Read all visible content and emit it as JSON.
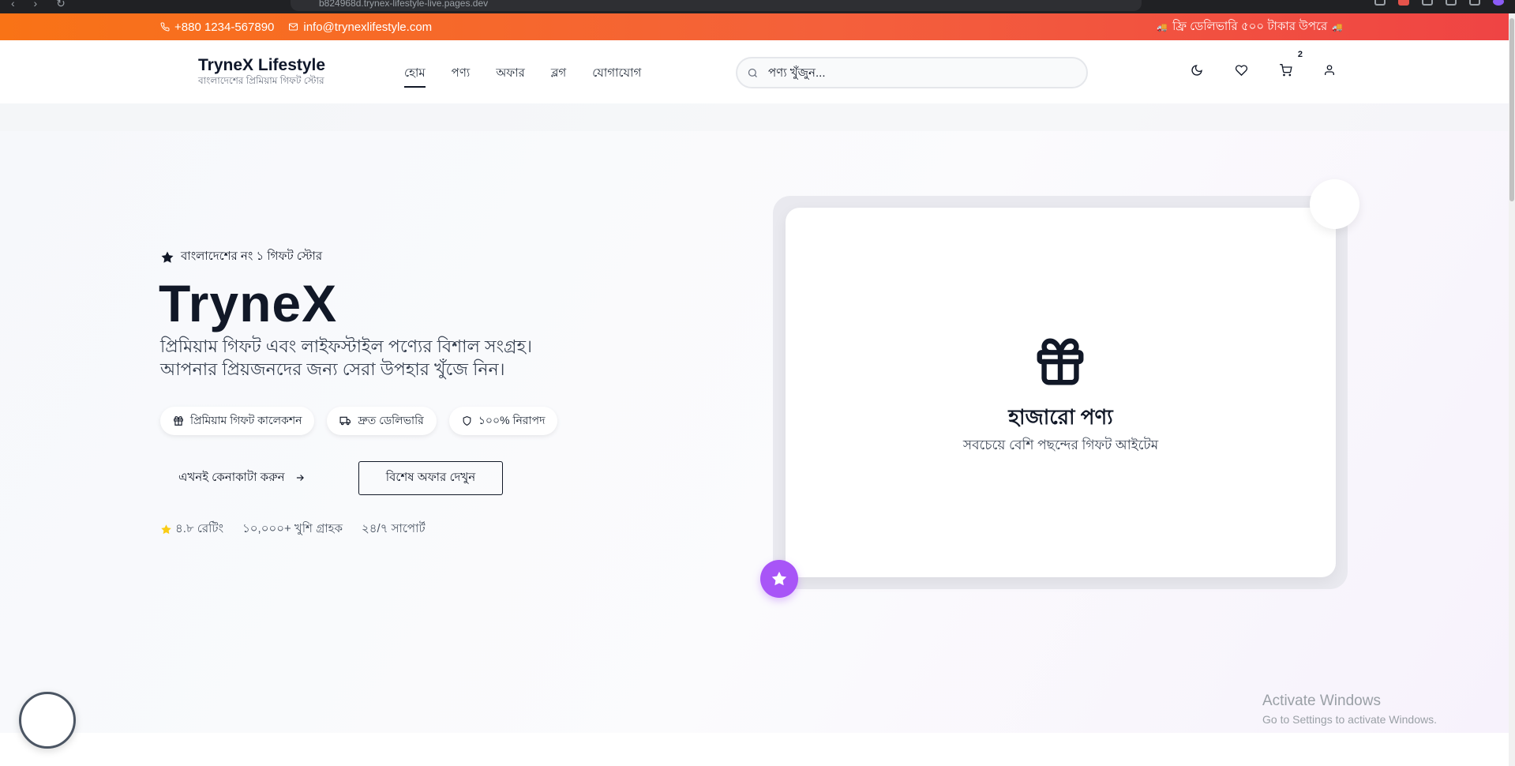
{
  "browser": {
    "url": "b824968d.trynex-lifestyle-live.pages.dev"
  },
  "topbar": {
    "phone": "+880 1234-567890",
    "email": "info@trynexlifestyle.com",
    "promo": "ফ্রি ডেলিভারি ৫০০ টাকার উপরে"
  },
  "header": {
    "brand_name": "TryneX Lifestyle",
    "brand_tagline": "বাংলাদেশের প্রিমিয়াম গিফট স্টোর",
    "nav": [
      "হোম",
      "পণ্য",
      "অফার",
      "ব্লগ",
      "যোগাযোগ"
    ],
    "search_placeholder": "পণ্য খুঁজুন...",
    "cart_count": "2",
    "icons": [
      "moon-icon",
      "heart-icon",
      "cart-icon",
      "user-icon"
    ]
  },
  "hero": {
    "eyebrow": "বাংলাদেশের নং ১ গিফট স্টোর",
    "title": "TryneX",
    "subtitle": "প্রিমিয়াম গিফট এবং লাইফস্টাইল পণ্যের বিশাল সংগ্রহ। আপনার প্রিয়জনদের জন্য সেরা উপহার খুঁজে নিন।",
    "pills": [
      "প্রিমিয়াম গিফট কালেকশন",
      "দ্রুত ডেলিভারি",
      "১০০% নিরাপদ"
    ],
    "cta_primary": "এখনই কেনাকাটা করুন",
    "cta_secondary": "বিশেষ অফার দেখুন",
    "stats": [
      "৪.৮ রেটিং",
      "১০,০০০+ খুশি গ্রাহক",
      "২৪/৭ সাপোর্ট"
    ]
  },
  "feature_card": {
    "title": "হাজারো পণ্য",
    "subtitle": "সবচেয়ে বেশি পছন্দের গিফট আইটেম"
  },
  "watermark": {
    "line1": "Activate Windows",
    "line2": "Go to Settings to activate Windows."
  },
  "colors": {
    "topbar_start": "#f97316",
    "topbar_end": "#ef4444",
    "accent_purple": "#a855f7",
    "star_yellow": "#facc15",
    "text_dark": "#111827"
  }
}
